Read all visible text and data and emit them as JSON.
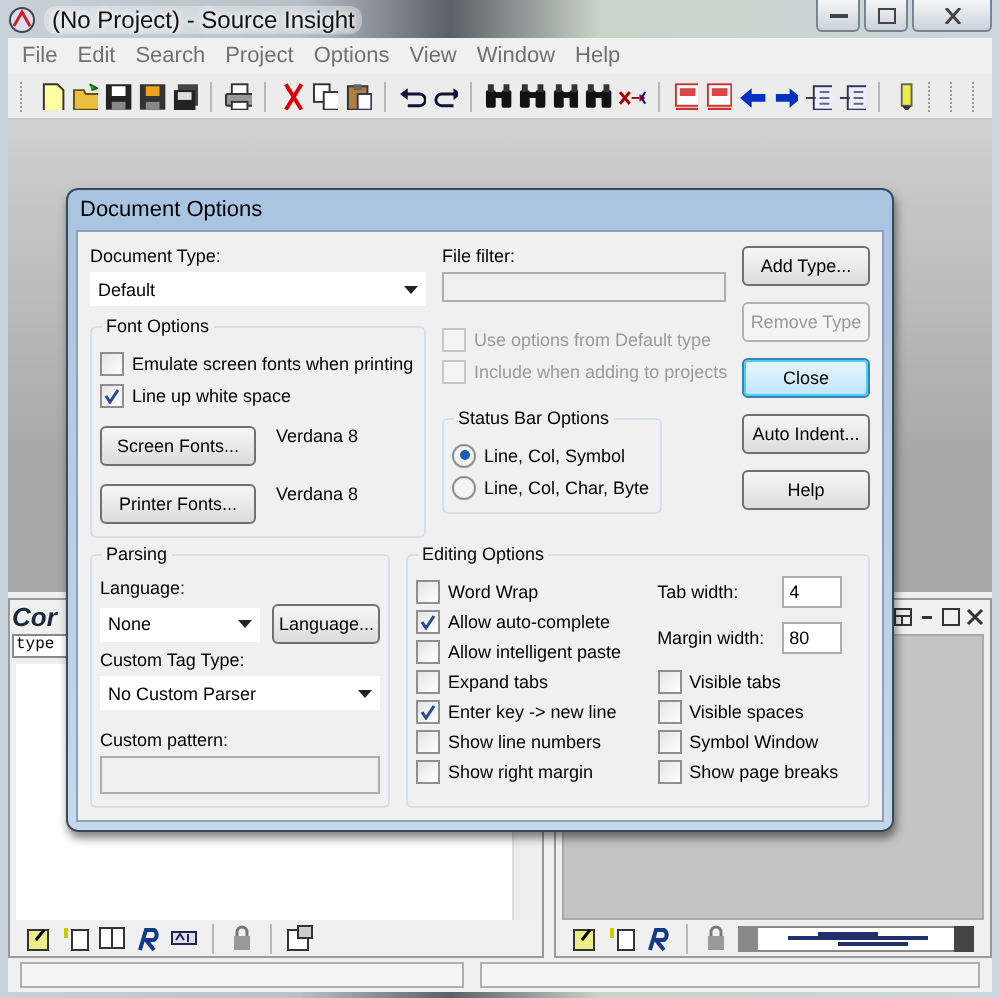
{
  "window": {
    "title": "(No Project) - Source Insight"
  },
  "menu": [
    "File",
    "Edit",
    "Search",
    "Project",
    "Options",
    "View",
    "Window",
    "Help"
  ],
  "context_panel": {
    "title": "Cor",
    "field": "type"
  },
  "dialog": {
    "title": "Document Options",
    "document_type": {
      "label": "Document Type:",
      "value": "Default"
    },
    "file_filter": {
      "label": "File filter:"
    },
    "type_checks": [
      {
        "label": "Use options from Default type",
        "checked": false,
        "disabled": true
      },
      {
        "label": "Include when adding to projects",
        "checked": false,
        "disabled": true
      }
    ],
    "font_options": {
      "title": "Font Options",
      "checks": [
        {
          "label": "Emulate screen fonts when printing",
          "checked": false
        },
        {
          "label": "Line up white space",
          "checked": true
        }
      ],
      "fonts": [
        {
          "button": "Screen Fonts...",
          "value": "Verdana 8"
        },
        {
          "button": "Printer Fonts...",
          "value": "Verdana 8"
        }
      ]
    },
    "status_bar_options": {
      "title": "Status Bar Options",
      "options": [
        {
          "label": "Line, Col, Symbol",
          "selected": true
        },
        {
          "label": "Line, Col, Char, Byte",
          "selected": false
        }
      ]
    },
    "buttons": [
      {
        "label": "Add Type...",
        "disabled": false,
        "default": false
      },
      {
        "label": "Remove Type",
        "disabled": true,
        "default": false
      },
      {
        "label": "Close",
        "disabled": false,
        "default": true
      },
      {
        "label": "Auto Indent...",
        "disabled": false,
        "default": false
      },
      {
        "label": "Help",
        "disabled": false,
        "default": false
      }
    ],
    "parsing": {
      "title": "Parsing",
      "language_label": "Language:",
      "language": "None",
      "language_button": "Language...",
      "tag_label": "Custom Tag Type:",
      "tag": "No Custom Parser",
      "pattern_label": "Custom pattern:"
    },
    "editing_options": {
      "title": "Editing Options",
      "left": [
        {
          "label": "Word Wrap",
          "checked": false
        },
        {
          "label": "Allow auto-complete",
          "checked": true
        },
        {
          "label": "Allow intelligent paste",
          "checked": false
        },
        {
          "label": "Expand tabs",
          "checked": false
        },
        {
          "label": "Enter key -> new line",
          "checked": true
        },
        {
          "label": "Show line numbers",
          "checked": false
        },
        {
          "label": "Show right margin",
          "checked": false
        }
      ],
      "tab_width": {
        "label": "Tab width:",
        "value": "4"
      },
      "margin_width": {
        "label": "Margin width:",
        "value": "80"
      },
      "right": [
        {
          "label": "Visible tabs",
          "checked": false
        },
        {
          "label": "Visible spaces",
          "checked": false
        },
        {
          "label": "Symbol Window",
          "checked": false
        },
        {
          "label": "Show page breaks",
          "checked": false
        }
      ]
    }
  }
}
